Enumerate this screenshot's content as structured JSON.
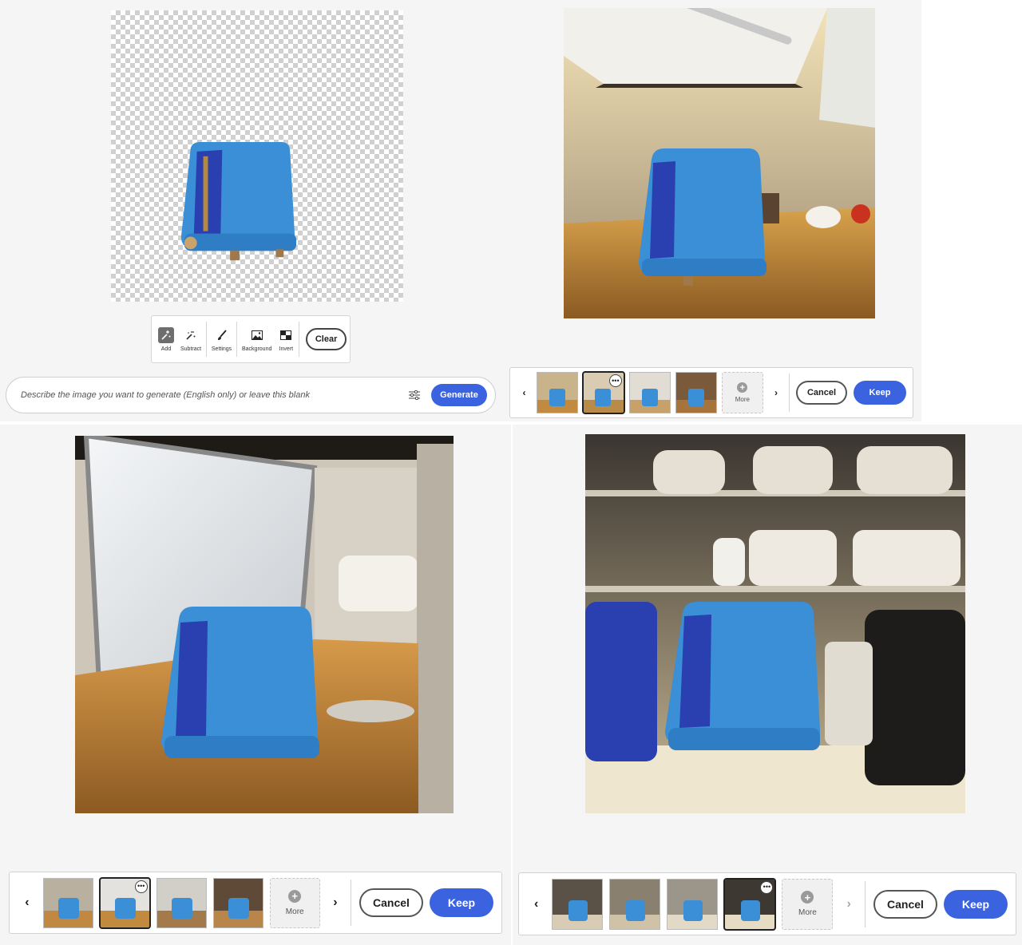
{
  "tools": {
    "items": [
      {
        "label": "Add",
        "icon": "add-selection-icon",
        "active": true
      },
      {
        "label": "Subtract",
        "icon": "subtract-selection-icon",
        "active": false
      },
      {
        "label": "Settings",
        "icon": "brush-icon",
        "active": false
      },
      {
        "label": "Background",
        "icon": "image-icon",
        "active": false
      },
      {
        "label": "Invert",
        "icon": "invert-icon",
        "active": false
      }
    ],
    "clear_label": "Clear"
  },
  "prompt": {
    "placeholder": "Describe the image you want to generate (English only) or leave this blank",
    "generate_label": "Generate"
  },
  "selector": {
    "more_label": "More",
    "cancel_label": "Cancel",
    "keep_label": "Keep",
    "more_options_glyph": "•••"
  },
  "colors": {
    "accent": "#3b63e0",
    "toaster_blue": "#3a8fd6"
  }
}
